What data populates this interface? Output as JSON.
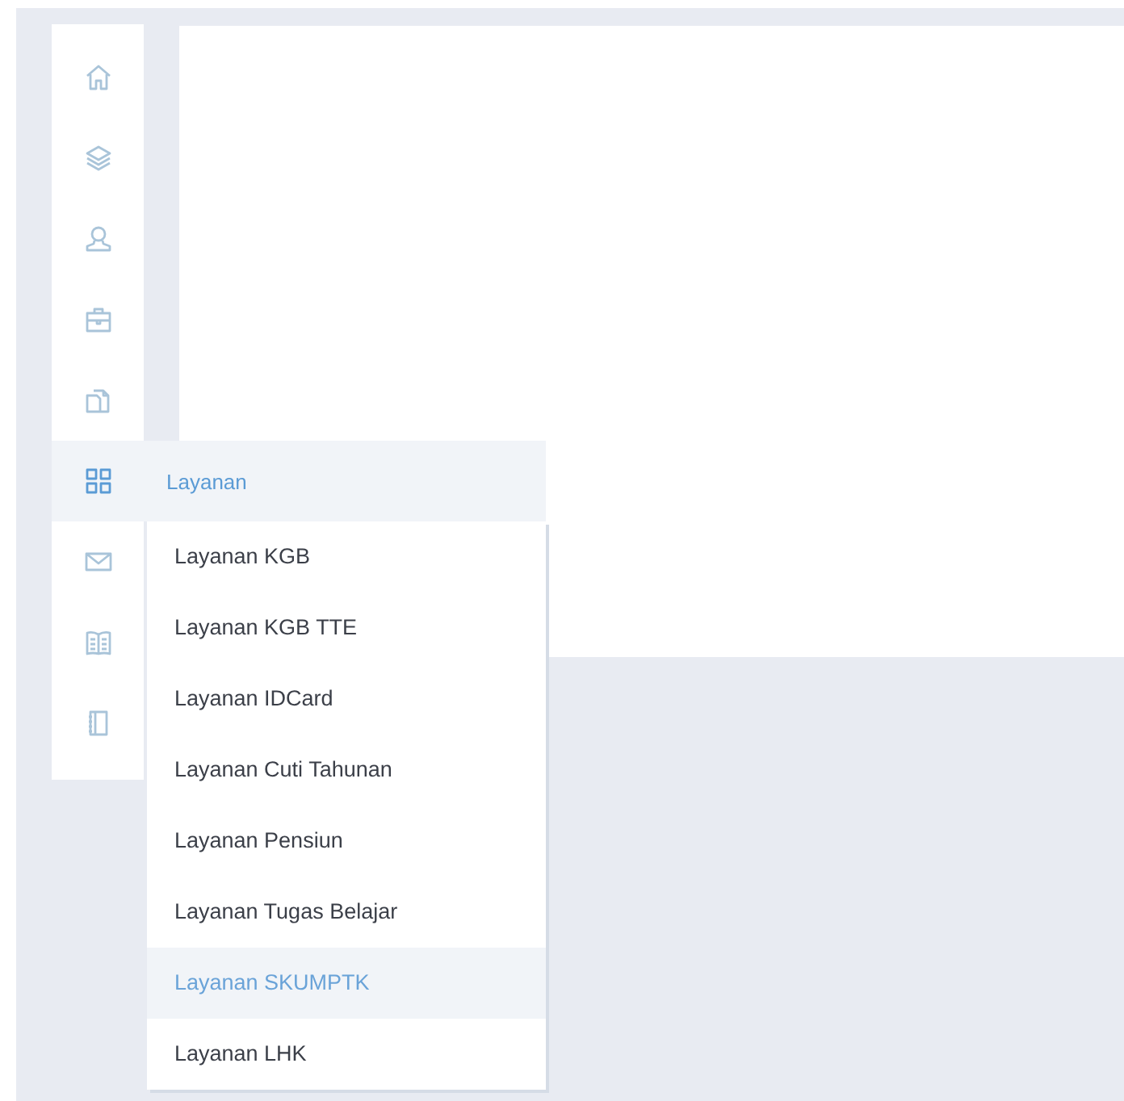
{
  "sidebar": {
    "items": [
      {
        "selected": false
      },
      {
        "selected": false
      },
      {
        "selected": false
      },
      {
        "selected": false
      },
      {
        "selected": false
      },
      {
        "selected": true
      },
      {
        "selected": false
      },
      {
        "selected": false
      },
      {
        "selected": false
      }
    ]
  },
  "flyout": {
    "title": "Layanan",
    "items": [
      {
        "label": "Layanan KGB",
        "selected": false
      },
      {
        "label": "Layanan KGB TTE",
        "selected": false
      },
      {
        "label": "Layanan IDCard",
        "selected": false
      },
      {
        "label": "Layanan Cuti Tahunan",
        "selected": false
      },
      {
        "label": "Layanan Pensiun",
        "selected": false
      },
      {
        "label": "Layanan Tugas Belajar",
        "selected": false
      },
      {
        "label": "Layanan SKUMPTK",
        "selected": true
      },
      {
        "label": "Layanan LHK",
        "selected": false
      }
    ]
  }
}
